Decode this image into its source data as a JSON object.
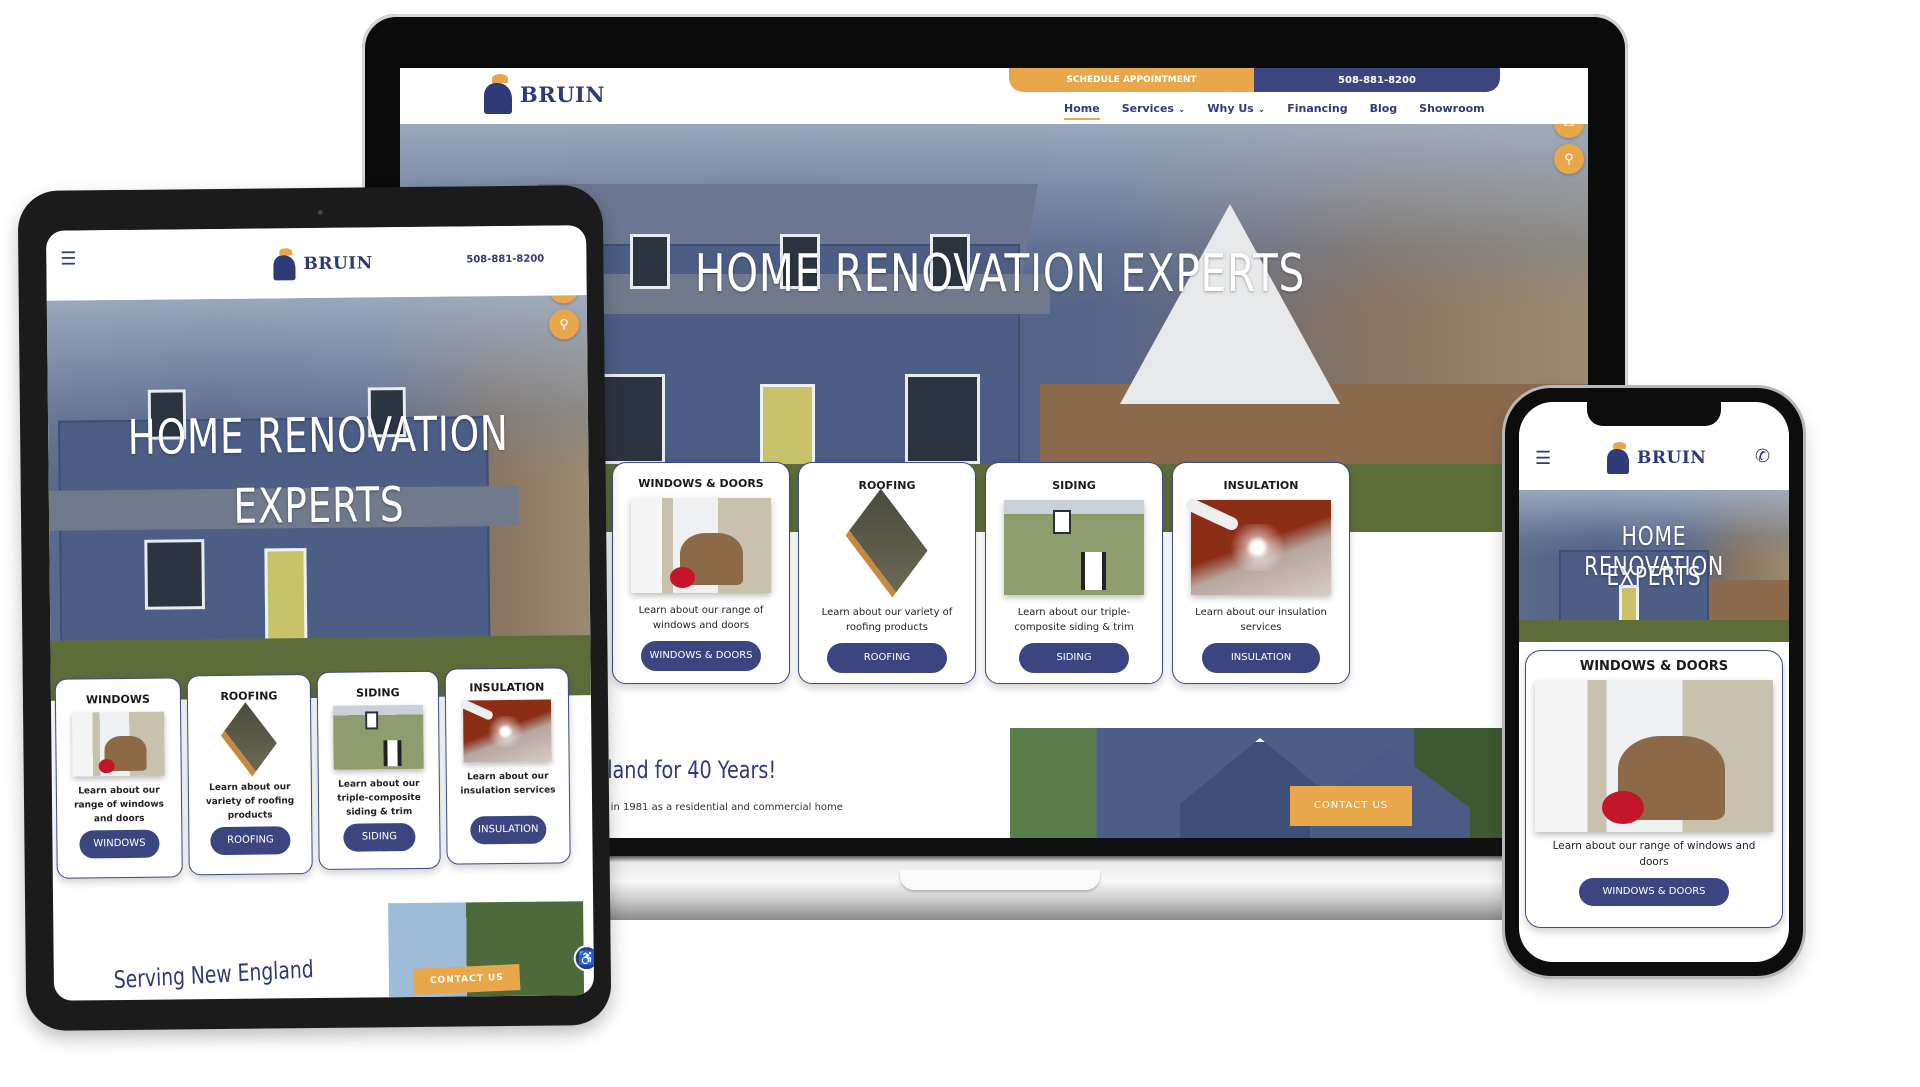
{
  "brand": {
    "name": "BRUIN",
    "colors": {
      "navy": "#2f3a78",
      "gold": "#e8a74a",
      "button": "#3b4580"
    }
  },
  "desktop": {
    "topbar": {
      "schedule_label": "SCHEDULE APPOINTMENT",
      "phone": "508-881-8200"
    },
    "nav": [
      {
        "label": "Home",
        "active": true
      },
      {
        "label": "Services",
        "dropdown": true
      },
      {
        "label": "Why Us",
        "dropdown": true
      },
      {
        "label": "Financing"
      },
      {
        "label": "Blog"
      },
      {
        "label": "Showroom"
      }
    ],
    "dropdown_glyph": "⌄",
    "fab": [
      {
        "icon": "phone-icon",
        "glyph": "✆"
      },
      {
        "icon": "mail-icon",
        "glyph": "✉"
      },
      {
        "icon": "map-pin-icon",
        "glyph": "⚲"
      }
    ],
    "hero_title": "HOME RENOVATION EXPERTS",
    "cards": [
      {
        "title": "WINDOWS & DOORS",
        "text": "Learn about our range of windows and doors",
        "button": "WINDOWS & DOORS"
      },
      {
        "title": "ROOFING",
        "text": "Learn about our variety of roofing products",
        "button": "ROOFING"
      },
      {
        "title": "SIDING",
        "text": "Learn about our triple-composite siding & trim",
        "button": "SIDING"
      },
      {
        "title": "INSULATION",
        "text": "Learn about our insulation services",
        "button": "INSULATION"
      }
    ],
    "about_heading": "gland for 40 Years!",
    "about_text": "ed in 1981 as a residential and commercial home",
    "contact_label": "CONTACT US"
  },
  "tablet": {
    "menu_glyph": "☰",
    "phone": "508-881-8200",
    "hero_title_line1": "HOME RENOVATION",
    "hero_title_line2": "EXPERTS",
    "cards": [
      {
        "title": "WINDOWS",
        "text": "Learn about our range of windows and doors",
        "button": "WINDOWS"
      },
      {
        "title": "ROOFING",
        "text": "Learn about our variety of roofing products",
        "button": "ROOFING"
      },
      {
        "title": "SIDING",
        "text": "Learn about our triple-composite siding & trim",
        "button": "SIDING"
      },
      {
        "title": "INSULATION",
        "text": "Learn about our insulation services",
        "button": "INSULATION"
      }
    ],
    "serving_heading": "Serving New England",
    "contact_label": "CONTACT US",
    "accessibility_glyph": "♿"
  },
  "phone": {
    "menu_glyph": "☰",
    "call_glyph": "✆",
    "hero_title_line1": "HOME RENOVATION",
    "hero_title_line2": "EXPERTS",
    "card": {
      "title": "WINDOWS & DOORS",
      "text": "Learn about our range of windows and doors",
      "button": "WINDOWS & DOORS"
    }
  }
}
